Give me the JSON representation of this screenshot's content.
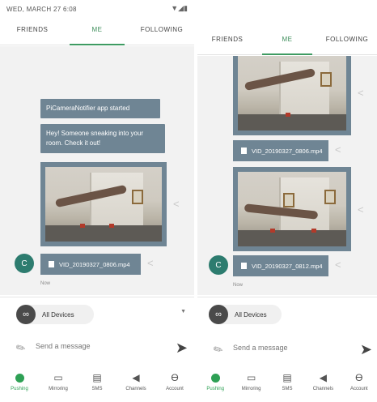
{
  "left": {
    "status_date": "WED, MARCH 27 6:08",
    "status_icons": "▼◢▮",
    "tabs": [
      "FRIENDS",
      "ME",
      "FOLLOWING"
    ],
    "messages": [
      "PiCameraNotifier app started",
      "Hey! Someone sneaking into your room. Check it out!"
    ],
    "file_name": "VID_20190327_0806.mp4",
    "time_label": "Now",
    "avatar_letter": "C",
    "device": "All Devices",
    "composer_placeholder": "Send a message",
    "nav": [
      "Pushing",
      "Mirroring",
      "SMS",
      "Channels",
      "Account"
    ]
  },
  "right": {
    "tabs": [
      "FRIENDS",
      "ME",
      "FOLLOWING"
    ],
    "file_name_1": "VID_20190327_0806.mp4",
    "file_name_2": "VID_20190327_0812.mp4",
    "time_label": "Now",
    "avatar_letter": "C",
    "device": "All Devices",
    "composer_placeholder": "Send a message",
    "nav": [
      "Pushing",
      "Mirroring",
      "SMS",
      "Channels",
      "Account"
    ]
  },
  "colors": {
    "accent_green": "#2ea055",
    "bubble": "#6f8594",
    "avatar": "#2d7c6f"
  },
  "icons": {
    "attach": "paperclip-icon",
    "send": "send-icon",
    "share": "share-icon",
    "device": "infinity-icon"
  }
}
